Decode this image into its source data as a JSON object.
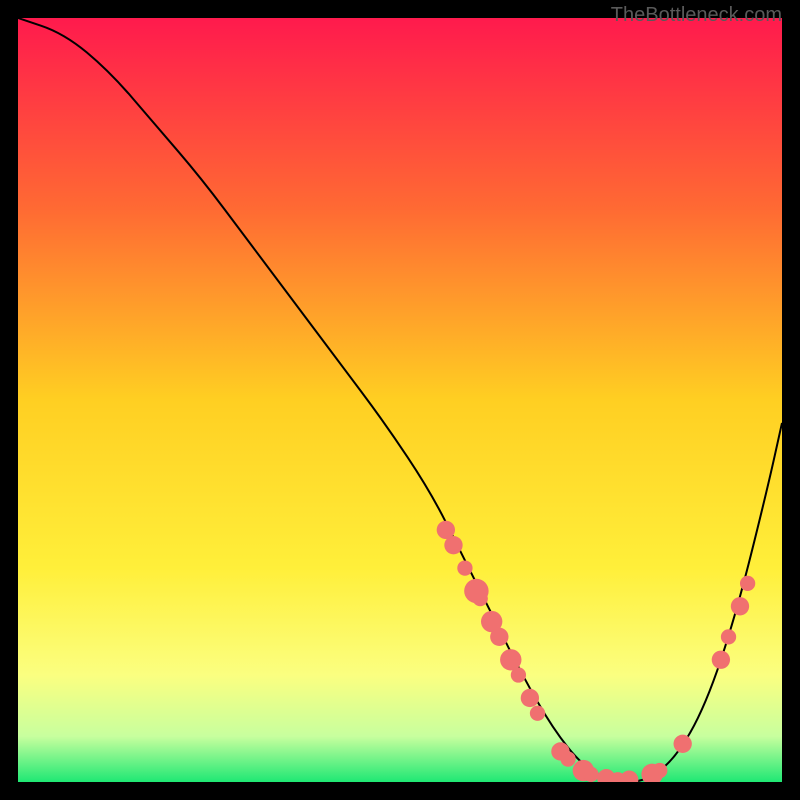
{
  "watermark": "TheBottleneck.com",
  "chart_data": {
    "type": "line",
    "title": "",
    "xlabel": "",
    "ylabel": "",
    "xlim": [
      0,
      100
    ],
    "ylim": [
      0,
      100
    ],
    "grid": false,
    "legend": false,
    "background_gradient": {
      "stops": [
        {
          "offset": 0,
          "color": "#ff1a4d"
        },
        {
          "offset": 25,
          "color": "#ff6a33"
        },
        {
          "offset": 50,
          "color": "#ffcf22"
        },
        {
          "offset": 72,
          "color": "#ffef3a"
        },
        {
          "offset": 86,
          "color": "#fbff80"
        },
        {
          "offset": 94,
          "color": "#c8ff9e"
        },
        {
          "offset": 100,
          "color": "#1fe874"
        }
      ]
    },
    "series": [
      {
        "name": "bottleneck-curve",
        "color": "#000000",
        "x": [
          0,
          6,
          12,
          18,
          24,
          30,
          36,
          42,
          48,
          54,
          58,
          62,
          66,
          70,
          74,
          78,
          82,
          86,
          90,
          94,
          98,
          100
        ],
        "y": [
          100,
          98,
          93,
          86,
          79,
          71,
          63,
          55,
          47,
          38,
          30,
          22,
          14,
          7,
          2,
          0,
          0,
          3,
          10,
          22,
          38,
          47
        ]
      }
    ],
    "points": [
      {
        "name": "marker",
        "x": 56,
        "y": 33,
        "r": 1.2
      },
      {
        "name": "marker",
        "x": 57,
        "y": 31,
        "r": 1.2
      },
      {
        "name": "marker",
        "x": 58.5,
        "y": 28,
        "r": 1.0
      },
      {
        "name": "marker",
        "x": 60,
        "y": 25,
        "r": 1.6
      },
      {
        "name": "marker",
        "x": 60.5,
        "y": 24,
        "r": 1.0
      },
      {
        "name": "marker",
        "x": 62,
        "y": 21,
        "r": 1.4
      },
      {
        "name": "marker",
        "x": 63,
        "y": 19,
        "r": 1.2
      },
      {
        "name": "marker",
        "x": 64.5,
        "y": 16,
        "r": 1.4
      },
      {
        "name": "marker",
        "x": 65.5,
        "y": 14,
        "r": 1.0
      },
      {
        "name": "marker",
        "x": 67,
        "y": 11,
        "r": 1.2
      },
      {
        "name": "marker",
        "x": 68,
        "y": 9,
        "r": 1.0
      },
      {
        "name": "marker",
        "x": 71,
        "y": 4,
        "r": 1.2
      },
      {
        "name": "marker",
        "x": 72,
        "y": 3,
        "r": 1.0
      },
      {
        "name": "marker",
        "x": 74,
        "y": 1.5,
        "r": 1.4
      },
      {
        "name": "marker",
        "x": 75,
        "y": 1,
        "r": 1.0
      },
      {
        "name": "marker",
        "x": 77,
        "y": 0.5,
        "r": 1.2
      },
      {
        "name": "marker",
        "x": 78.5,
        "y": 0.3,
        "r": 1.0
      },
      {
        "name": "marker",
        "x": 80,
        "y": 0.3,
        "r": 1.2
      },
      {
        "name": "marker",
        "x": 83,
        "y": 1,
        "r": 1.4
      },
      {
        "name": "marker",
        "x": 84,
        "y": 1.5,
        "r": 1.0
      },
      {
        "name": "marker",
        "x": 87,
        "y": 5,
        "r": 1.2
      },
      {
        "name": "marker",
        "x": 92,
        "y": 16,
        "r": 1.2
      },
      {
        "name": "marker",
        "x": 93,
        "y": 19,
        "r": 1.0
      },
      {
        "name": "marker",
        "x": 94.5,
        "y": 23,
        "r": 1.2
      },
      {
        "name": "marker",
        "x": 95.5,
        "y": 26,
        "r": 1.0
      }
    ],
    "point_color": "#f07070"
  }
}
